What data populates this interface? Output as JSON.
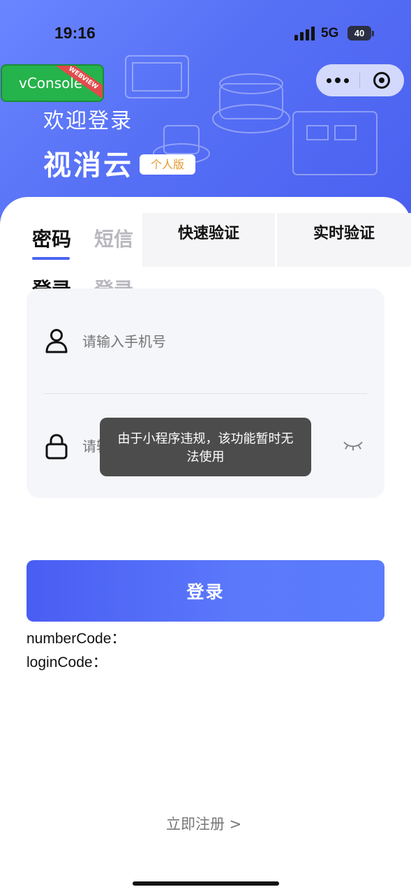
{
  "status_bar": {
    "time": "19:16",
    "network": "5G",
    "battery": "40"
  },
  "debug_badge": {
    "label": "vConsole",
    "ribbon": "WEBVIEW"
  },
  "header": {
    "welcome": "欢迎登录",
    "brand": "视消云",
    "edition": "个人版"
  },
  "login_tabs": [
    {
      "line1": "密码",
      "line2": "登录",
      "active": true
    },
    {
      "line1": "短信",
      "line2": "登录",
      "active": false
    }
  ],
  "verify_tabs": [
    {
      "label": "快速验证"
    },
    {
      "label": "实时验证"
    }
  ],
  "form": {
    "phone_placeholder": "请输入手机号",
    "password_placeholder": "请输入密码"
  },
  "toast": {
    "message": "由于小程序违规，该功能暂时无法使用"
  },
  "login_button": "登录",
  "debug_fields": {
    "number_code": "numberCode：",
    "login_code": "loginCode："
  },
  "register_link": "立即注册 >",
  "colors": {
    "accent": "#4b64f2",
    "header_gradient_start": "#6a86ff",
    "header_gradient_end": "#4a5ff0",
    "toast_bg": "#4c4c4c",
    "edition_text": "#e79a2c",
    "vconsole_green": "#25b34b"
  },
  "icons": [
    "signal-icon",
    "battery-icon",
    "more-icon",
    "close-circle-icon",
    "user-icon",
    "lock-icon",
    "eye-closed-icon"
  ]
}
